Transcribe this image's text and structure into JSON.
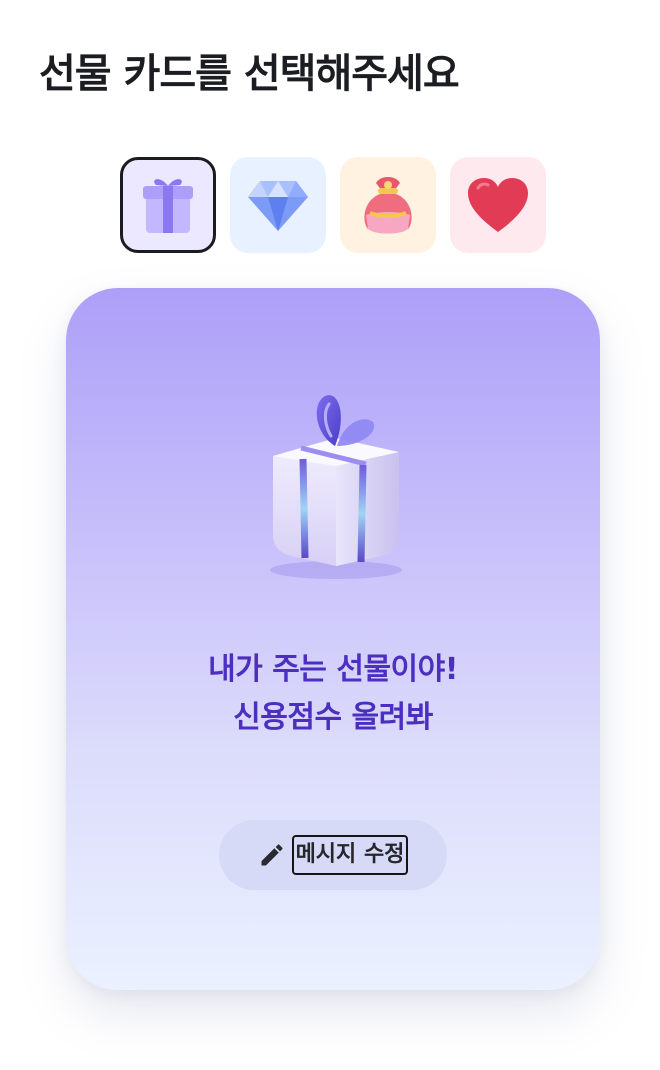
{
  "page": {
    "title": "선물 카드를 선택해주세요"
  },
  "card_options": [
    {
      "id": "gift",
      "icon": "gift-icon",
      "selected": true,
      "bg_color": "#ece8ff"
    },
    {
      "id": "diamond",
      "icon": "diamond-icon",
      "selected": false,
      "bg_color": "#e8f1ff"
    },
    {
      "id": "pouch",
      "icon": "lucky-pouch-icon",
      "selected": false,
      "bg_color": "#fff2e0"
    },
    {
      "id": "heart",
      "icon": "heart-icon",
      "selected": false,
      "bg_color": "#fde9ee"
    }
  ],
  "card_preview": {
    "icon": "gift-box-illustration",
    "message_line1": "내가 주는 선물이야!",
    "message_line2": "신용점수 올려봐",
    "message_color": "#4c2fbf",
    "edit_icon": "pencil-icon",
    "edit_label": "메시지 수정"
  },
  "colors": {
    "title": "#1c1d22",
    "selected_border": "#1b1c22",
    "card_top": "#ad9ff8",
    "card_bottom": "#ebf1ff"
  }
}
